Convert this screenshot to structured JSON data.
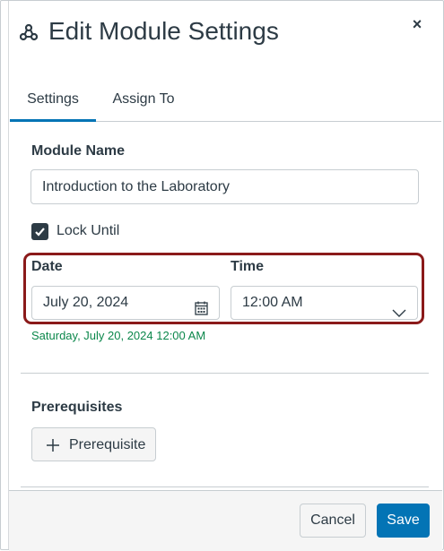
{
  "header": {
    "title": "Edit Module Settings",
    "title_icon": "modules-icon",
    "close_label": "×"
  },
  "tabs": [
    {
      "label": "Settings",
      "active": true
    },
    {
      "label": "Assign To",
      "active": false
    }
  ],
  "module_name": {
    "label": "Module Name",
    "value": "Introduction to the Laboratory"
  },
  "lock_until": {
    "label": "Lock Until",
    "checked": true
  },
  "date": {
    "label": "Date",
    "value": "July 20, 2024",
    "icon": "calendar-icon"
  },
  "time": {
    "label": "Time",
    "value": "12:00 AM",
    "icon": "chevron-down-icon"
  },
  "helper_text": "Saturday, July 20, 2024 12:00 AM",
  "prerequisites": {
    "label": "Prerequisites",
    "add_button": "Prerequisite"
  },
  "footer": {
    "cancel": "Cancel",
    "save": "Save"
  },
  "colors": {
    "accent": "#0374b5",
    "text": "#2d3b45",
    "success": "#0b874b",
    "highlight": "#8b1a1a"
  }
}
